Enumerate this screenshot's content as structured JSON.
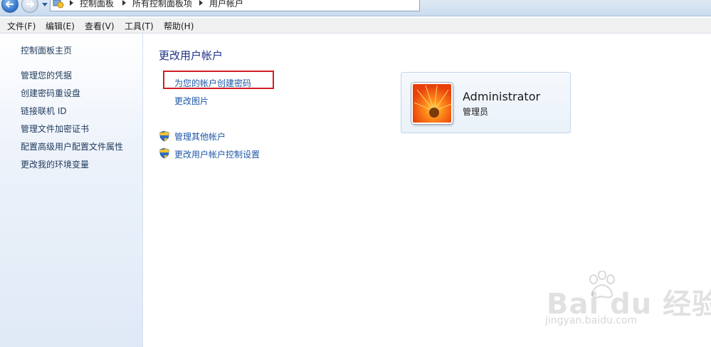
{
  "breadcrumb": [
    "控制面板",
    "所有控制面板项",
    "用户帐户"
  ],
  "menu": [
    "文件(F)",
    "编辑(E)",
    "查看(V)",
    "工具(T)",
    "帮助(H)"
  ],
  "sidebar": {
    "home": "控制面板主页",
    "items": [
      "管理您的凭据",
      "创建密码重设盘",
      "链接联机 ID",
      "管理文件加密证书",
      "配置高级用户配置文件属性",
      "更改我的环境变量"
    ]
  },
  "main": {
    "title": "更改用户帐户",
    "tasks": [
      "为您的帐户创建密码",
      "更改图片"
    ],
    "shield_tasks": [
      "管理其他帐户",
      "更改用户帐户控制设置"
    ]
  },
  "account": {
    "name": "Administrator",
    "role": "管理员"
  },
  "watermark": {
    "brand": "Bai du 经验",
    "url": "jingyan.baidu.com"
  },
  "colors": {
    "link": "#1e57a8",
    "title": "#1e3287",
    "highlight": "#d11f23"
  }
}
